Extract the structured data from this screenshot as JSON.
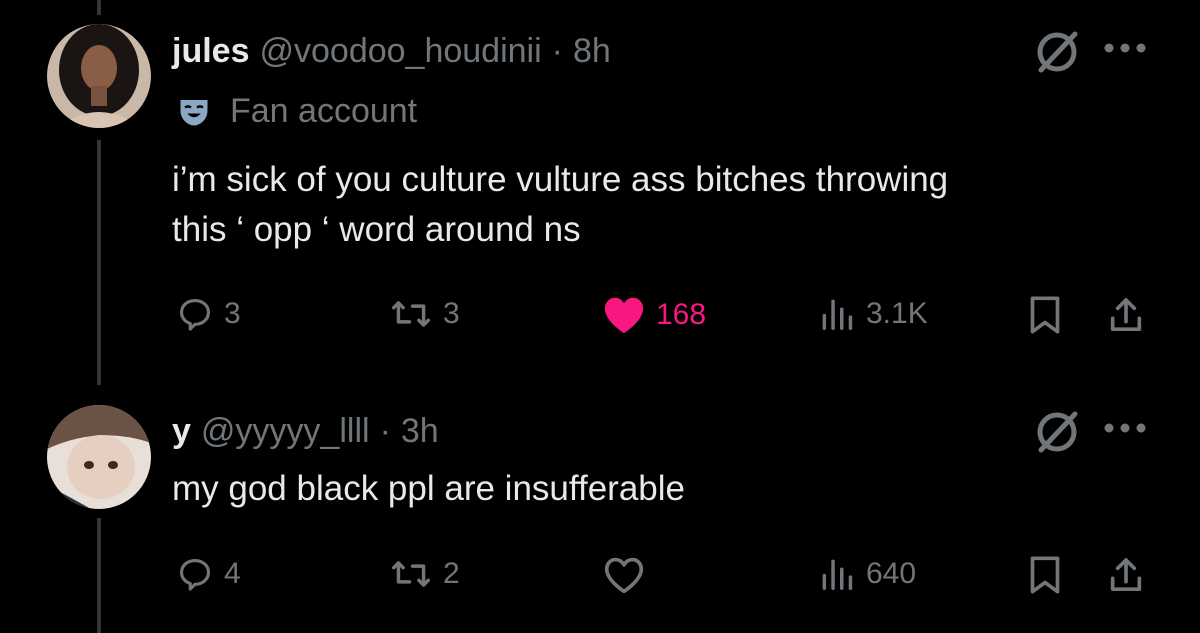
{
  "tweets": [
    {
      "name": "jules",
      "handle": "@voodoo_houdinii",
      "separator": "·",
      "time": "8h",
      "label": "Fan account",
      "text": "i’m sick of you culture vulture ass bitches throwing\nthis ‘ opp ‘ word around ns",
      "replies": "3",
      "reposts": "3",
      "likes": "168",
      "liked": true,
      "views": "3.1K"
    },
    {
      "name": "y",
      "handle": "@yyyyy_llll",
      "separator": "·",
      "time": "3h",
      "text": "my god black ppl are insufferable",
      "replies": "4",
      "reposts": "2",
      "likes": "",
      "liked": false,
      "views": "640"
    }
  ],
  "colors": {
    "background": "#000000",
    "text": "#e7e9ea",
    "muted": "#71767b",
    "like": "#f91880"
  },
  "icons": [
    "grok-icon",
    "more-icon",
    "mask-icon",
    "reply-icon",
    "repost-icon",
    "like-icon",
    "views-icon",
    "bookmark-icon",
    "share-icon"
  ]
}
